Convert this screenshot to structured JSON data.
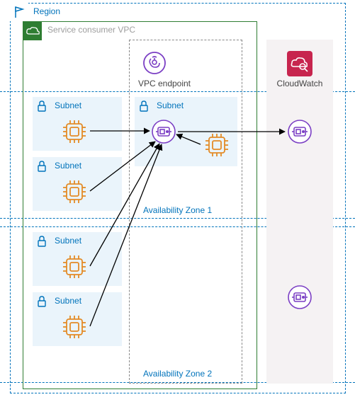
{
  "region": {
    "label": "Region"
  },
  "vpc": {
    "label": "Service consumer VPC"
  },
  "endpoint": {
    "label": "VPC endpoint"
  },
  "cloudwatch": {
    "label": "CloudWatch"
  },
  "az": {
    "one": "Availability Zone 1",
    "two": "Availability Zone 2"
  },
  "subnet": {
    "a": {
      "label": "Subnet"
    },
    "b": {
      "label": "Subnet"
    },
    "c": {
      "label": "Subnet"
    },
    "d": {
      "label": "Subnet"
    },
    "e": {
      "label": "Subnet"
    }
  },
  "chart_data": {
    "type": "diagram",
    "title": "",
    "nodes": [
      {
        "id": "region",
        "kind": "region",
        "label": "Region"
      },
      {
        "id": "vpc",
        "kind": "vpc",
        "label": "Service consumer VPC",
        "parent": "region"
      },
      {
        "id": "endpoint_group",
        "kind": "vpc-endpoint",
        "label": "VPC endpoint",
        "parent": "vpc"
      },
      {
        "id": "az1",
        "kind": "availability-zone",
        "label": "Availability Zone 1",
        "parent": "region"
      },
      {
        "id": "az2",
        "kind": "availability-zone",
        "label": "Availability Zone 2",
        "parent": "region"
      },
      {
        "id": "cloudwatch",
        "kind": "aws-service",
        "label": "CloudWatch",
        "parent": "region"
      },
      {
        "id": "subnetA",
        "kind": "subnet",
        "label": "Subnet",
        "parent": "vpc",
        "zone": "az1"
      },
      {
        "id": "subnetB",
        "kind": "subnet",
        "label": "Subnet",
        "parent": "vpc",
        "zone": "az1"
      },
      {
        "id": "subnetC",
        "kind": "subnet",
        "label": "Subnet",
        "parent": "vpc",
        "zone": "az2"
      },
      {
        "id": "subnetD",
        "kind": "subnet",
        "label": "Subnet",
        "parent": "vpc",
        "zone": "az2"
      },
      {
        "id": "subnetE",
        "kind": "subnet",
        "label": "Subnet",
        "parent": "endpoint_group",
        "zone": "az1"
      },
      {
        "id": "instA",
        "kind": "instance",
        "parent": "subnetA"
      },
      {
        "id": "instB",
        "kind": "instance",
        "parent": "subnetB"
      },
      {
        "id": "instC",
        "kind": "instance",
        "parent": "subnetC"
      },
      {
        "id": "instD",
        "kind": "instance",
        "parent": "subnetD"
      },
      {
        "id": "instE",
        "kind": "instance",
        "parent": "subnetE"
      },
      {
        "id": "eni1",
        "kind": "eni",
        "parent": "subnetE",
        "zone": "az1"
      },
      {
        "id": "eni_cw1",
        "kind": "eni",
        "parent": "cloudwatch",
        "zone": "az1"
      },
      {
        "id": "eni_cw2",
        "kind": "eni",
        "parent": "cloudwatch",
        "zone": "az2"
      }
    ],
    "edges": [
      {
        "from": "instA",
        "to": "eni1",
        "direction": "forward"
      },
      {
        "from": "instB",
        "to": "eni1",
        "direction": "forward"
      },
      {
        "from": "instC",
        "to": "eni1",
        "direction": "forward"
      },
      {
        "from": "instD",
        "to": "eni1",
        "direction": "forward"
      },
      {
        "from": "instE",
        "to": "eni1",
        "direction": "forward"
      },
      {
        "from": "eni1",
        "to": "eni_cw1",
        "direction": "forward"
      }
    ]
  },
  "colors": {
    "region_border": "#0073bb",
    "vpc_border": "#2e7d32",
    "subnet_bg": "#eaf4fb",
    "compute": "#e38b27",
    "networking": "#7b3fc4",
    "management": "#c7254e"
  }
}
